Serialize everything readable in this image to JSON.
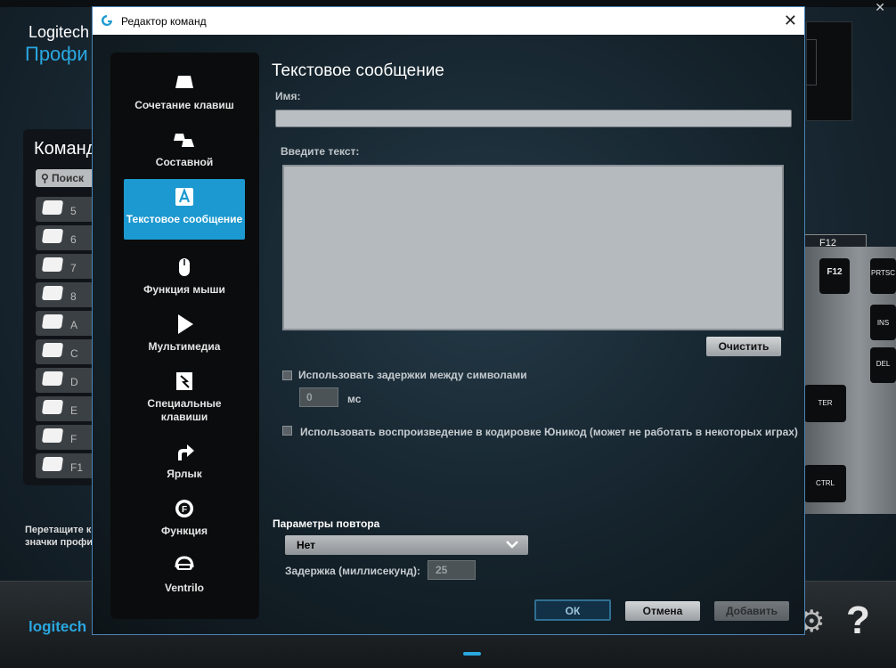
{
  "background_app": {
    "brand": "Logitech",
    "profile_label": "Профи",
    "commands_title": "Команд",
    "search_placeholder": "Поиск",
    "command_rows": [
      "5",
      "6",
      "7",
      "8",
      "A",
      "C",
      "D",
      "E",
      "F",
      "F1"
    ],
    "hint_text": "Перетащите к значки профи",
    "footer_brand": "logitech",
    "keyboard": {
      "f12_tag": "F12",
      "keys": [
        "F12",
        "PRTSC",
        "INS",
        "DEL",
        "TER",
        "CTRL"
      ]
    },
    "accent_color": "#2aa7e0"
  },
  "dialog": {
    "title": "Редактор команд",
    "close_icon": "close-icon",
    "logo_icon": "logitech-g-icon",
    "sidebar": [
      {
        "label": "Сочетание клавиш",
        "icon": "keystroke-icon"
      },
      {
        "label": "Составной",
        "icon": "multikey-icon"
      },
      {
        "label": "Текстовое сообщение",
        "icon": "text-block-icon",
        "active": true
      },
      {
        "label": "Функция мыши",
        "icon": "mouse-icon"
      },
      {
        "label": "Мультимедиа",
        "icon": "play-icon"
      },
      {
        "label": "Специальные клавиши",
        "icon": "hotkey-icon"
      },
      {
        "label": "Ярлык",
        "icon": "shortcut-arrow-icon"
      },
      {
        "label": "Функция",
        "icon": "function-gear-icon"
      },
      {
        "label": "Ventrilo",
        "icon": "ventrilo-headset-icon"
      }
    ],
    "content": {
      "title": "Текстовое сообщение",
      "name_label": "Имя:",
      "name_value": "",
      "text_label": "Введите текст:",
      "text_value": "",
      "clear_button": "Очистить",
      "use_delays_label": "Использовать задержки между символами",
      "use_delays_checked": false,
      "delay_value": "0",
      "delay_unit": "мс",
      "unicode_label": "Использовать воспроизведение в кодировке Юникод (может не работать в некоторых играх)",
      "unicode_checked": false
    },
    "repeat": {
      "title": "Параметры повтора",
      "selected": "Нет",
      "delay_label": "Задержка (миллисекунд):",
      "delay_value": "25"
    },
    "buttons": {
      "ok": "ОК",
      "cancel": "Отмена",
      "add": "Добавить"
    },
    "active_color": "#1c99d0"
  }
}
